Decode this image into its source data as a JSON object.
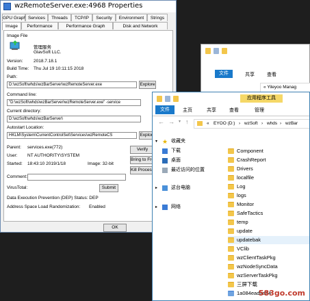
{
  "props_window": {
    "title": "wzRemoteServer.exe:4968 Properties",
    "tabs_row1": [
      "GPU Graph",
      "Services",
      "Threads",
      "TCP/IP",
      "Security",
      "Environment",
      "Strings"
    ],
    "tabs_row2": [
      "Image",
      "Performance",
      "Performance Graph",
      "Disk and Network"
    ],
    "selected_tab": "Image",
    "image_file_label": "Image File",
    "description": "管理服务",
    "company": "GlavSoft LLC.",
    "version_label": "Version:",
    "version": "2018.7.18.1",
    "build_time_label": "Build Time:",
    "build_time": "Thu Jul 19 10:11:15 2018",
    "path_label": "Path:",
    "path": "D:\\wzSoft\\whds\\wzBarServer\\wzRemoteServer.exe",
    "explore_label": "Explore",
    "cmdline_label": "Command line:",
    "cmdline": "\"D:\\wzSoft\\whds\\wzBarServer\\wzRemoteServer.exe\" -service",
    "curdir_label": "Current directory:",
    "curdir": "D:\\wzSoft\\whds\\wzBarServer\\",
    "autostart_label": "Autostart Location:",
    "autostart": "HKLM\\System\\CurrentControlSet\\Services\\wzRemoteCS",
    "explore2_label": "Explore",
    "parent_label": "Parent:",
    "parent": "services.exe(772)",
    "user_label": "User:",
    "user": "NT AUTHORITY\\SYSTEM",
    "started_label": "Started:",
    "started": "18:43:10   2019/1/18",
    "image_bits": "Image: 32-bit",
    "verify_label": "Verify",
    "bring_front_label": "Bring to Front",
    "kill_label": "Kill Process",
    "comment_label": "Comment:",
    "virustotal_label": "VirusTotal:",
    "submit_label": "Submit",
    "dep_text": "Data Execution Prevention (DEP) Status:  DEP",
    "aslr_label": "Address Space Load Randomization:",
    "aslr_value": "Enabled",
    "ok_label": "OK"
  },
  "explorer_back": {
    "tab_file": "文件",
    "tab_share": "共享",
    "tab_view": "查看",
    "address": "Yileyoo Manag"
  },
  "explorer_front": {
    "context_tab": "应用程序工具",
    "tab_file": "文件",
    "tab_home": "主页",
    "tab_share": "共享",
    "tab_view": "查看",
    "tab_manage": "管理",
    "address": [
      "EYOO (D:)",
      "wzSoft",
      "whds",
      "wzBar"
    ],
    "nav": {
      "favorites": "收藏夹",
      "downloads": "下载",
      "desktop": "桌面",
      "recent": "最近访问的位置",
      "this_pc": "这台电脑",
      "network": "网络"
    },
    "folders": [
      "Component",
      "CrashReport",
      "Drivers",
      "localfile",
      "Log",
      "logs",
      "Monitor",
      "SafeTactics",
      "temp",
      "update",
      "updatebak",
      "VClib",
      "wzClientTaskPkg",
      "wzNodeSyncData",
      "wzServerTaskPkg",
      "三屏下载",
      "1a084eadae24"
    ],
    "watermark": "583go.com"
  },
  "colors": {
    "ribbon_blue": "#1979ca",
    "context_yellow": "#f5d867",
    "folder": "#f3c64b"
  }
}
